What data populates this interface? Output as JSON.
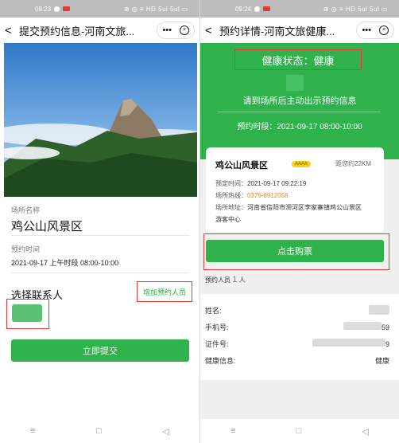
{
  "left": {
    "status": {
      "time": "09:23",
      "icons": "⊕ ◎ ≡ HD 5ul 5ul ▭"
    },
    "nav": {
      "back": "<",
      "title": "提交预约信息-河南文旅...",
      "more": "•••",
      "close": "×"
    },
    "venue": {
      "label": "场所名称",
      "value": "鸡公山风景区"
    },
    "appointment": {
      "label": "预约时间",
      "value": "2021-09-17 上午时段 08:00-10:00"
    },
    "contacts": {
      "title": "选择联系人",
      "add_button": "增加预约人员"
    },
    "submit_label": "立即提交",
    "bottom_nav": {
      "menu": "≡",
      "home": "□",
      "back": "◁"
    }
  },
  "right": {
    "status": {
      "time": "09:24",
      "icons": "⊕ ◎ ≡ HD 5ul 5ul ▭"
    },
    "nav": {
      "back": "<",
      "title": "预约详情-河南文旅健康...",
      "more": "•••",
      "close": "×"
    },
    "health_status": "健康状态：健康",
    "hint": "请到场所后主动出示预约信息",
    "appointment_time": "预约时段：2021-09-17 08:00-10:00",
    "card": {
      "name": "鸡公山风景区",
      "grade": "AAAA",
      "distance": "距您约22KM",
      "booked_label": "预定时间：",
      "booked_value": "2021-09-17 09:22:19",
      "hotline_label": "场所热线：",
      "hotline_value": "0376-6912058",
      "address_label": "场所地址：",
      "address_value": "河南省信阳市浉河区李家寨镇鸡公山景区",
      "address_value2": "游客中心"
    },
    "buy_label": "点击购票",
    "people": {
      "label": "预约人员",
      "count": "1",
      "unit": "人"
    },
    "info": {
      "name_label": "姓名:",
      "phone_label": "手机号:",
      "phone_tail": "59",
      "id_label": "证件号:",
      "id_tail": "9",
      "health_label": "健康信息:",
      "health_value": "健康"
    },
    "bottom_nav": {
      "menu": "≡",
      "home": "□",
      "back": "◁"
    }
  },
  "colors": {
    "primary_green": "#2fb14b",
    "highlight_red": "#e53935",
    "phone_orange": "#e9892b",
    "grade_yellow": "#f6d21c"
  }
}
